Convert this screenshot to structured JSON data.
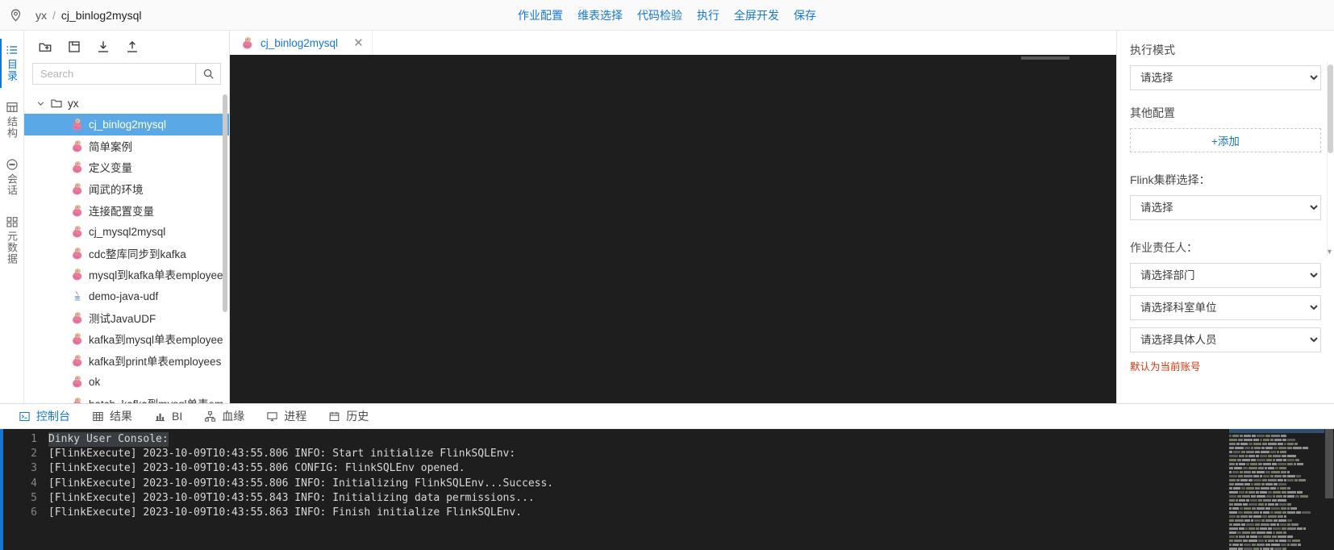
{
  "breadcrumb": {
    "root": "yx",
    "separator": "/",
    "current": "cj_binlog2mysql"
  },
  "topmenu": [
    {
      "label": "作业配置",
      "name": "job-config"
    },
    {
      "label": "维表选择",
      "name": "dim-table-select"
    },
    {
      "label": "代码检验",
      "name": "code-check"
    },
    {
      "label": "执行",
      "name": "execute"
    },
    {
      "label": "全屏开发",
      "name": "fullscreen-dev"
    },
    {
      "label": "保存",
      "name": "save"
    }
  ],
  "rail": [
    {
      "label": "目录",
      "icon": "list-icon",
      "active": true
    },
    {
      "label": "结构",
      "icon": "table-icon",
      "active": false
    },
    {
      "label": "会话",
      "icon": "chat-icon",
      "active": false
    },
    {
      "label": "元数据",
      "icon": "database-icon",
      "active": false
    }
  ],
  "tree_toolbar": [
    {
      "name": "new-folder-icon"
    },
    {
      "name": "new-file-icon"
    },
    {
      "name": "import-icon"
    },
    {
      "name": "export-icon"
    }
  ],
  "search": {
    "value": "",
    "placeholder": "Search",
    "icon": "search-icon"
  },
  "tree": {
    "root": {
      "label": "yx",
      "expanded": true
    },
    "items": [
      {
        "label": "cj_binlog2mysql",
        "icon": "flink-squirrel-icon",
        "selected": true
      },
      {
        "label": "简单案例",
        "icon": "flink-squirrel-icon",
        "selected": false
      },
      {
        "label": "定义变量",
        "icon": "flink-squirrel-icon",
        "selected": false
      },
      {
        "label": "闻武的环境",
        "icon": "flink-squirrel-icon",
        "selected": false
      },
      {
        "label": "连接配置变量",
        "icon": "flink-squirrel-icon",
        "selected": false
      },
      {
        "label": "cj_mysql2mysql",
        "icon": "flink-squirrel-icon",
        "selected": false
      },
      {
        "label": "cdc整库同步到kafka",
        "icon": "flink-squirrel-icon",
        "selected": false
      },
      {
        "label": "mysql到kafka单表employee",
        "icon": "flink-squirrel-icon",
        "selected": false
      },
      {
        "label": "demo-java-udf",
        "icon": "java-icon",
        "selected": false
      },
      {
        "label": "测试JavaUDF",
        "icon": "flink-squirrel-icon",
        "selected": false
      },
      {
        "label": "kafka到mysql单表employee",
        "icon": "flink-squirrel-icon",
        "selected": false
      },
      {
        "label": "kafka到print单表employees",
        "icon": "flink-squirrel-icon",
        "selected": false
      },
      {
        "label": "ok",
        "icon": "flink-squirrel-icon",
        "selected": false
      },
      {
        "label": "batch_kafka到mysql单表em",
        "icon": "flink-squirrel-icon",
        "selected": false
      }
    ]
  },
  "editor": {
    "tabs": [
      {
        "label": "cj_binlog2mysql",
        "icon": "flink-squirrel-icon",
        "active": true,
        "close": "✕"
      }
    ]
  },
  "config": {
    "exec_mode_label": "执行模式",
    "exec_mode_value": "请选择",
    "other_config_label": "其他配置",
    "add_label": "+添加",
    "flink_cluster_label": "Flink集群选择：",
    "flink_cluster_value": "请选择",
    "owner_label": "作业责任人：",
    "dept_value": "请选择部门",
    "unit_value": "请选择科室单位",
    "person_value": "请选择具体人员",
    "hint": "默认为当前账号"
  },
  "console": {
    "tabs": [
      {
        "label": "控制台",
        "icon": "terminal-icon",
        "active": true
      },
      {
        "label": "结果",
        "icon": "grid-icon",
        "active": false
      },
      {
        "label": "BI",
        "icon": "chart-icon",
        "active": false
      },
      {
        "label": "血缘",
        "icon": "lineage-icon",
        "active": false
      },
      {
        "label": "进程",
        "icon": "monitor-icon",
        "active": false
      },
      {
        "label": "历史",
        "icon": "history-icon",
        "active": false
      }
    ],
    "lines": [
      {
        "no": "1",
        "text": "Dinky User Console:",
        "highlight": true
      },
      {
        "no": "2",
        "text": "[FlinkExecute] 2023-10-09T10:43:55.806 INFO: Start initialize FlinkSQLEnv:",
        "highlight": false
      },
      {
        "no": "3",
        "text": "[FlinkExecute] 2023-10-09T10:43:55.806 CONFIG: FlinkSQLEnv opened.",
        "highlight": false
      },
      {
        "no": "4",
        "text": "[FlinkExecute] 2023-10-09T10:43:55.806 INFO: Initializing FlinkSQLEnv...Success.",
        "highlight": false
      },
      {
        "no": "5",
        "text": "[FlinkExecute] 2023-10-09T10:43:55.843 INFO: Initializing data permissions...",
        "highlight": false
      },
      {
        "no": "6",
        "text": "[FlinkExecute] 2023-10-09T10:43:55.863 INFO: Finish initialize FlinkSQLEnv.",
        "highlight": false
      }
    ]
  },
  "colors": {
    "accent": "#1677d2",
    "selection": "#5aa9e6",
    "editor_bg": "#1e1e1e",
    "warning": "#d4380d"
  }
}
